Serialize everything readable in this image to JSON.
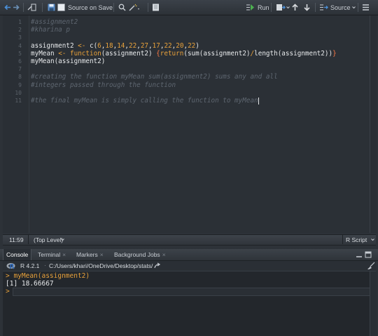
{
  "toolbar": {
    "source_on_save": "Source on Save",
    "run": "Run",
    "source": "Source"
  },
  "editor": {
    "line_numbers": [
      "1",
      "2",
      "3",
      "4",
      "5",
      "6",
      "7",
      "8",
      "9",
      "10",
      "11"
    ],
    "lines": [
      {
        "segments": [
          {
            "t": "#assignment2",
            "c": "cmt"
          }
        ]
      },
      {
        "segments": [
          {
            "t": "#kharina p",
            "c": "cmt"
          }
        ]
      },
      {
        "segments": []
      },
      {
        "segments": [
          {
            "t": "assignment2 ",
            "c": "fn"
          },
          {
            "t": "<-",
            "c": "op"
          },
          {
            "t": " c(",
            "c": "fn"
          },
          {
            "t": "6",
            "c": "num"
          },
          {
            "t": ",",
            "c": "fn"
          },
          {
            "t": "18",
            "c": "num"
          },
          {
            "t": ",",
            "c": "fn"
          },
          {
            "t": "14",
            "c": "num"
          },
          {
            "t": ",",
            "c": "fn"
          },
          {
            "t": "22",
            "c": "num"
          },
          {
            "t": ",",
            "c": "fn"
          },
          {
            "t": "27",
            "c": "num"
          },
          {
            "t": ",",
            "c": "fn"
          },
          {
            "t": "17",
            "c": "num"
          },
          {
            "t": ",",
            "c": "fn"
          },
          {
            "t": "22",
            "c": "num"
          },
          {
            "t": ",",
            "c": "fn"
          },
          {
            "t": "20",
            "c": "num"
          },
          {
            "t": ",",
            "c": "fn"
          },
          {
            "t": "22",
            "c": "num"
          },
          {
            "t": ")",
            "c": "fn"
          }
        ]
      },
      {
        "segments": [
          {
            "t": "myMean ",
            "c": "fn"
          },
          {
            "t": "<-",
            "c": "op"
          },
          {
            "t": " ",
            "c": "fn"
          },
          {
            "t": "function",
            "c": "kw"
          },
          {
            "t": "(assignment2) ",
            "c": "fn"
          },
          {
            "t": "{",
            "c": "brace"
          },
          {
            "t": "return",
            "c": "kw"
          },
          {
            "t": "(sum(assignment2)",
            "c": "fn"
          },
          {
            "t": "/",
            "c": "op"
          },
          {
            "t": "length(assignment2))",
            "c": "fn"
          },
          {
            "t": "}",
            "c": "brace"
          }
        ]
      },
      {
        "segments": [
          {
            "t": "myMean(assignment2)",
            "c": "fn"
          }
        ]
      },
      {
        "segments": []
      },
      {
        "segments": [
          {
            "t": "#creating the function myMean sum(assignment2) sums any and all",
            "c": "cmt"
          }
        ]
      },
      {
        "segments": [
          {
            "t": "#integers passed through the function",
            "c": "cmt"
          }
        ]
      },
      {
        "segments": []
      },
      {
        "segments": [
          {
            "t": "#the final myMean is simply calling the function to myMean",
            "c": "cmt"
          }
        ]
      }
    ]
  },
  "status": {
    "position": "11:59",
    "scope": "(Top Level)",
    "file_type": "R Script"
  },
  "console_tabs": [
    {
      "label": "Console",
      "active": true
    },
    {
      "label": "Terminal",
      "active": false
    },
    {
      "label": "Markers",
      "active": false
    },
    {
      "label": "Background Jobs",
      "active": false
    }
  ],
  "console_path": {
    "r_version": "R 4.2.1",
    "path": "C:/Users/khari/OneDrive/Desktop/stats/"
  },
  "console_output": [
    {
      "text": "> myMean(assignment2)",
      "color": "#e8a13a"
    },
    {
      "text": "[1] 18.66667",
      "color": "#e8eaec"
    },
    {
      "text": ">",
      "color": "#e8a13a"
    }
  ],
  "colors": {
    "accent_blue": "#4a90d9",
    "comment": "#5e6670",
    "operator": "#e8a13a"
  }
}
